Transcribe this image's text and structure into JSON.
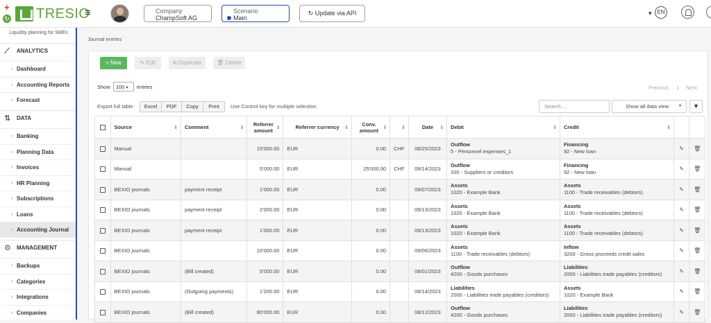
{
  "app": {
    "brand": "TRESIO",
    "tagline": "Liquidity planning for SMEs"
  },
  "header": {
    "company_label": "Company",
    "company_value": "ChampSoft AG",
    "scenario_label": "Scenario",
    "scenario_value": "Main",
    "api_button": "Update via API",
    "language": "EN"
  },
  "sidebar": {
    "sections": [
      {
        "label": "ANALYTICS",
        "icon": "chart-line-icon",
        "items": [
          "Dashboard",
          "Accounting Reports",
          "Forecast"
        ]
      },
      {
        "label": "DATA",
        "icon": "sliders-icon",
        "items": [
          "Banking",
          "Planning Data",
          "Invoices",
          "HR Planning",
          "Subscriptions",
          "Loans",
          "Accounting Journal"
        ]
      },
      {
        "label": "MANAGEMENT",
        "icon": "gear-icon",
        "items": [
          "Backups",
          "Categories",
          "Integrations",
          "Companies"
        ]
      }
    ],
    "active_item": "Accounting Journal"
  },
  "page": {
    "breadcrumb": "Journal entries"
  },
  "toolbar": {
    "new": "New",
    "edit": "Edit",
    "duplicate": "Duplicate",
    "delete": "Delete"
  },
  "table_controls": {
    "show_label": "Show",
    "page_size": "100",
    "entries_label": "entries",
    "previous": "Previous",
    "page": "1",
    "next": "Next",
    "export_label": "Export full table",
    "export_buttons": [
      "Excel",
      "PDF",
      "Copy",
      "Print"
    ],
    "export_note": "Use Control key for multiple selection",
    "search_placeholder": "Search ...",
    "view_select": "Show all data view"
  },
  "table": {
    "columns": [
      "",
      "Source",
      "Comment",
      "Referrer amount",
      "Referrer currency",
      "Conv. amount",
      "",
      "Date",
      "Debit",
      "Credit",
      "",
      ""
    ],
    "rows": [
      {
        "source": "Manual",
        "comment": "",
        "ref_amount": "15'000.00",
        "ref_currency": "EUR",
        "conv_amount": "0.00",
        "conv_currency": "CHF",
        "date": "08/25/2023",
        "debit_title": "Outflow",
        "debit_sub": "5 - Personnel expenses_1",
        "credit_title": "Financing",
        "credit_sub": "92 - New loan"
      },
      {
        "source": "Manual",
        "comment": "",
        "ref_amount": "5'000.00",
        "ref_currency": "EUR",
        "conv_amount": "25'000.00",
        "conv_currency": "CHF",
        "date": "09/14/2023",
        "debit_title": "Outflow",
        "debit_sub": "200 - Suppliers or creditors",
        "credit_title": "Financing",
        "credit_sub": "92 - New loan"
      },
      {
        "source": "BEXIO journals",
        "comment": "payment receipt",
        "ref_amount": "1'000.00",
        "ref_currency": "EUR",
        "conv_amount": "0.00",
        "conv_currency": "",
        "date": "09/07/2023",
        "debit_title": "Assets",
        "debit_sub": "1020 - Example Bank",
        "credit_title": "Assets",
        "credit_sub": "1100 - Trade receivables (debtors)"
      },
      {
        "source": "BEXIO journals",
        "comment": "payment receipt",
        "ref_amount": "2'000.00",
        "ref_currency": "EUR",
        "conv_amount": "0.00",
        "conv_currency": "",
        "date": "09/13/2023",
        "debit_title": "Assets",
        "debit_sub": "1020 - Example Bank",
        "credit_title": "Assets",
        "credit_sub": "1100 - Trade receivables (debtors)"
      },
      {
        "source": "BEXIO journals",
        "comment": "payment receipt",
        "ref_amount": "1'000.00",
        "ref_currency": "EUR",
        "conv_amount": "0.00",
        "conv_currency": "",
        "date": "09/13/2023",
        "debit_title": "Assets",
        "debit_sub": "1020 - Example Bank",
        "credit_title": "Assets",
        "credit_sub": "1100 - Trade receivables (debtors)"
      },
      {
        "source": "BEXIO journals",
        "comment": "",
        "ref_amount": "10'000.00",
        "ref_currency": "EUR",
        "conv_amount": "0.00",
        "conv_currency": "",
        "date": "09/06/2023",
        "debit_title": "Assets",
        "debit_sub": "1100 - Trade receivables (debtors)",
        "credit_title": "Inflow",
        "credit_sub": "3200 - Gross proceeds credit sales"
      },
      {
        "source": "BEXIO journals",
        "comment": "(Bill created)",
        "ref_amount": "5'000.00",
        "ref_currency": "EUR",
        "conv_amount": "0.00",
        "conv_currency": "",
        "date": "08/01/2023",
        "debit_title": "Outflow",
        "debit_sub": "4200 - Goods purchases",
        "credit_title": "Liabilities",
        "credit_sub": "2000 - Liabilities trade payables (creditors)"
      },
      {
        "source": "BEXIO journals",
        "comment": "(Outgoing payments)",
        "ref_amount": "1'200.00",
        "ref_currency": "EUR",
        "conv_amount": "0.00",
        "conv_currency": "",
        "date": "09/14/2023",
        "debit_title": "Liabilities",
        "debit_sub": "2000 - Liabilities trade payables (creditors)",
        "credit_title": "Assets",
        "credit_sub": "1020 - Example Bank"
      },
      {
        "source": "BEXIO journals",
        "comment": "(Bill created)",
        "ref_amount": "80'000.00",
        "ref_currency": "EUR",
        "conv_amount": "0.00",
        "conv_currency": "",
        "date": "08/12/2023",
        "debit_title": "Outflow",
        "debit_sub": "4200 - Goods purchases",
        "credit_title": "Liabilities",
        "credit_sub": "2000 - Liabilities trade payables (creditors)"
      }
    ]
  },
  "colors": {
    "brand_green": "#5aa637",
    "accent_blue": "#1f4fa8",
    "new_button": "#5cb85c"
  }
}
